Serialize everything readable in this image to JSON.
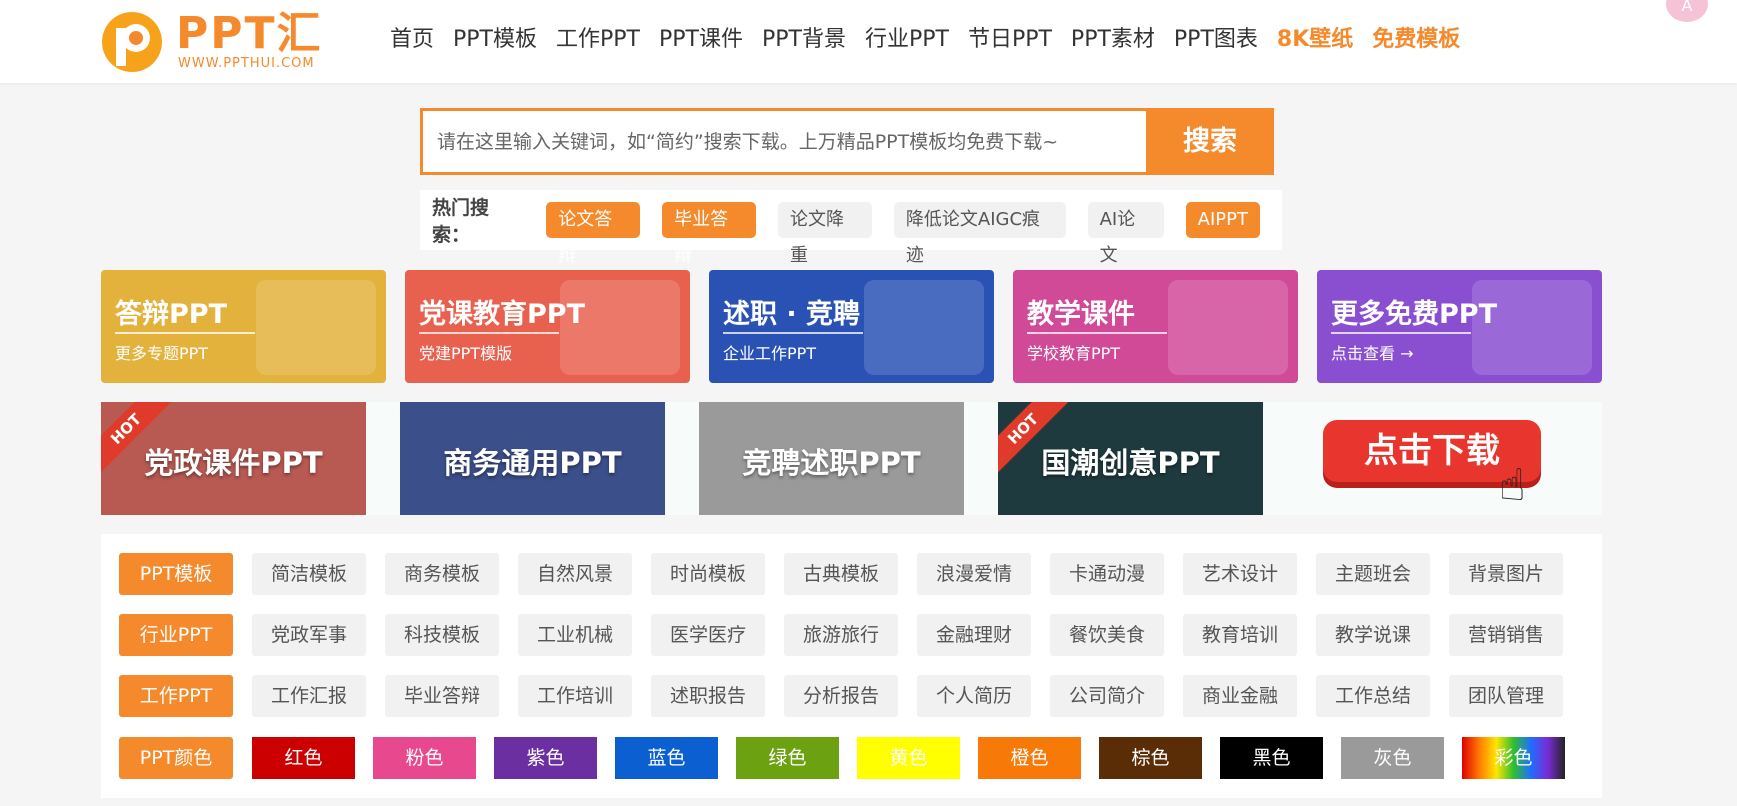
{
  "header": {
    "logo_word": "PPT汇",
    "logo_url": "WWW.PPTHUI.COM",
    "nav": [
      {
        "label": "首页",
        "hl": false
      },
      {
        "label": "PPT模板",
        "hl": false
      },
      {
        "label": "工作PPT",
        "hl": false
      },
      {
        "label": "PPT课件",
        "hl": false
      },
      {
        "label": "PPT背景",
        "hl": false
      },
      {
        "label": "行业PPT",
        "hl": false
      },
      {
        "label": "节日PPT",
        "hl": false
      },
      {
        "label": "PPT素材",
        "hl": false
      },
      {
        "label": "PPT图表",
        "hl": false
      },
      {
        "label": "8K壁纸",
        "hl": true
      },
      {
        "label": "免费模板",
        "hl": true
      }
    ],
    "avatar_text": "A"
  },
  "search": {
    "placeholder": "请在这里输入关键词，如“简约”搜索下载。上万精品PPT模板均免费下载~",
    "button": "搜索"
  },
  "hot": {
    "label": "热门搜索：",
    "tags": [
      {
        "label": "论文答辩",
        "on": true
      },
      {
        "label": "毕业答辩",
        "on": true
      },
      {
        "label": "论文降重",
        "on": false
      },
      {
        "label": "降低论文AIGC痕迹",
        "on": false
      },
      {
        "label": "AI论文",
        "on": false
      },
      {
        "label": "AIPPT",
        "on": true
      }
    ]
  },
  "banners": [
    {
      "title": "答辩PPT",
      "sub": "更多专题PPT",
      "color": "#e3b23c"
    },
    {
      "title": "党课教育PPT",
      "sub": "党建PPT模版",
      "color": "#e8614f"
    },
    {
      "title": "述职 · 竞聘",
      "sub": "企业工作PPT",
      "color": "#2a52b5"
    },
    {
      "title": "教学课件",
      "sub": "学校教育PPT",
      "color": "#d14a98"
    },
    {
      "title": "更多免费PPT",
      "sub": "点击查看 →",
      "color": "#8a4fd0"
    }
  ],
  "cards": [
    {
      "title": "党政课件PPT",
      "hot": true,
      "color": "#b85a52"
    },
    {
      "title": "商务通用PPT",
      "hot": false,
      "color": "#3b4f8a"
    },
    {
      "title": "竞聘述职PPT",
      "hot": false,
      "color": "#9a9a9a"
    },
    {
      "title": "国潮创意PPT",
      "hot": true,
      "color": "#1f3a3f"
    }
  ],
  "hot_ribbon": "HOT",
  "download_label": "点击下载",
  "categories": [
    {
      "head": "PPT模板",
      "items": [
        "简洁模板",
        "商务模板",
        "自然风景",
        "时尚模板",
        "古典模板",
        "浪漫爱情",
        "卡通动漫",
        "艺术设计",
        "主题班会",
        "背景图片"
      ]
    },
    {
      "head": "行业PPT",
      "items": [
        "党政军事",
        "科技模板",
        "工业机械",
        "医学医疗",
        "旅游旅行",
        "金融理财",
        "餐饮美食",
        "教育培训",
        "教学说课",
        "营销销售"
      ]
    },
    {
      "head": "工作PPT",
      "items": [
        "工作汇报",
        "毕业答辩",
        "工作培训",
        "述职报告",
        "分析报告",
        "个人简历",
        "公司简介",
        "商业金融",
        "工作总结",
        "团队管理"
      ]
    }
  ],
  "colors": {
    "head": "PPT颜色",
    "items": [
      {
        "label": "红色",
        "color": "#cc0000"
      },
      {
        "label": "粉色",
        "color": "#e8488d"
      },
      {
        "label": "紫色",
        "color": "#6b2fa1"
      },
      {
        "label": "蓝色",
        "color": "#0b5fd0"
      },
      {
        "label": "绿色",
        "color": "#6ca111"
      },
      {
        "label": "黄色",
        "color": "#ffff00"
      },
      {
        "label": "橙色",
        "color": "#f77a08"
      },
      {
        "label": "棕色",
        "color": "#5a2d07"
      },
      {
        "label": "黑色",
        "color": "#000000"
      },
      {
        "label": "灰色",
        "color": "#9a9a9a"
      },
      {
        "label": "彩色",
        "color": "rainbow"
      }
    ]
  }
}
